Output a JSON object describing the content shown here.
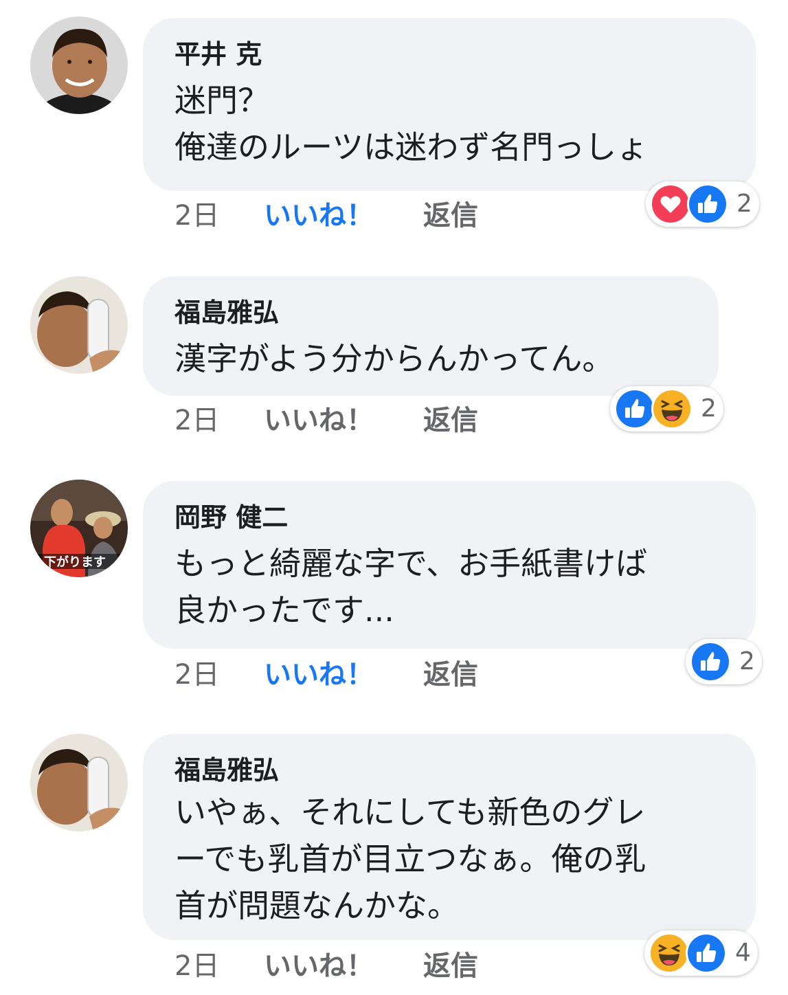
{
  "colors": {
    "bubble": "#f0f2f5",
    "like_blue": "#1877f2",
    "love_red": "#f33e58",
    "haha_yellow": "#f7b125",
    "meta_gray": "#65676b"
  },
  "comments": [
    {
      "author": "平井 克",
      "lines": [
        "迷門？",
        "俺達のルーツは迷わず名門っしょ"
      ],
      "time": "2日",
      "like_label": "いいね！",
      "like_active": true,
      "reply_label": "返信",
      "reactions": [
        "heart-icon",
        "thumbs-up-icon"
      ],
      "reaction_count": "2"
    },
    {
      "author": "福島雅弘",
      "lines": [
        "漢字がよう分からんかってん。"
      ],
      "time": "2日",
      "like_label": "いいね！",
      "like_active": false,
      "reply_label": "返信",
      "reactions": [
        "thumbs-up-icon",
        "laughing-face-icon"
      ],
      "reaction_count": "2"
    },
    {
      "author": "岡野 健二",
      "lines": [
        "もっと綺麗な字で、お手紙書けば",
        "良かったです..."
      ],
      "avatar_caption": "下がります",
      "time": "2日",
      "like_label": "いいね！",
      "like_active": true,
      "reply_label": "返信",
      "reactions": [
        "thumbs-up-icon"
      ],
      "reaction_count": "2"
    },
    {
      "author": "福島雅弘",
      "lines": [
        "いやぁ、それにしても新色のグレ",
        "ーでも乳首が目立つなぁ。俺の乳",
        "首が問題なんかな。"
      ],
      "time": "2日",
      "like_label": "いいね！",
      "like_active": false,
      "reply_label": "返信",
      "reactions": [
        "laughing-face-icon",
        "thumbs-up-icon"
      ],
      "reaction_count": "4"
    }
  ]
}
